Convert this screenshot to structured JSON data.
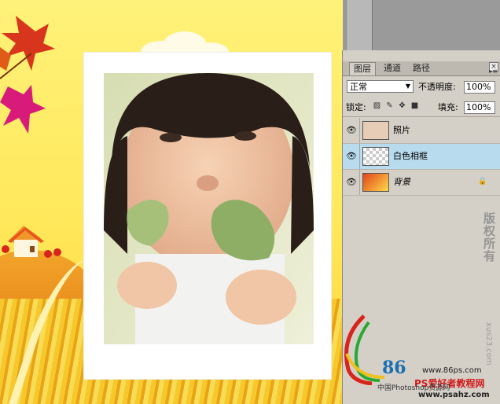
{
  "layers_panel": {
    "tabs": [
      "图层",
      "通道",
      "路径"
    ],
    "blend_mode": "正常",
    "opacity_label": "不透明度:",
    "opacity_value": "100%",
    "lock_label": "锁定:",
    "fill_label": "填充:",
    "fill_value": "100%",
    "layers": [
      {
        "name": "照片",
        "visible": true,
        "selected": false,
        "locked": false
      },
      {
        "name": "白色相框",
        "visible": true,
        "selected": true,
        "locked": false
      },
      {
        "name": "背景",
        "visible": true,
        "selected": false,
        "locked": true
      }
    ]
  },
  "watermark": {
    "vertical_text": "版权所有",
    "vertical_small": "xus23.com",
    "url1": "www.86ps.com",
    "number": "86",
    "site_name": "PS爱好者教程网",
    "cn_label": "中国Photoshop资源网",
    "url2": "www.psahz.com"
  },
  "colors": {
    "selected_layer": "#b8dcee",
    "panel_bg": "#d4d0c8",
    "canvas_yellow": "#ffe85a"
  }
}
